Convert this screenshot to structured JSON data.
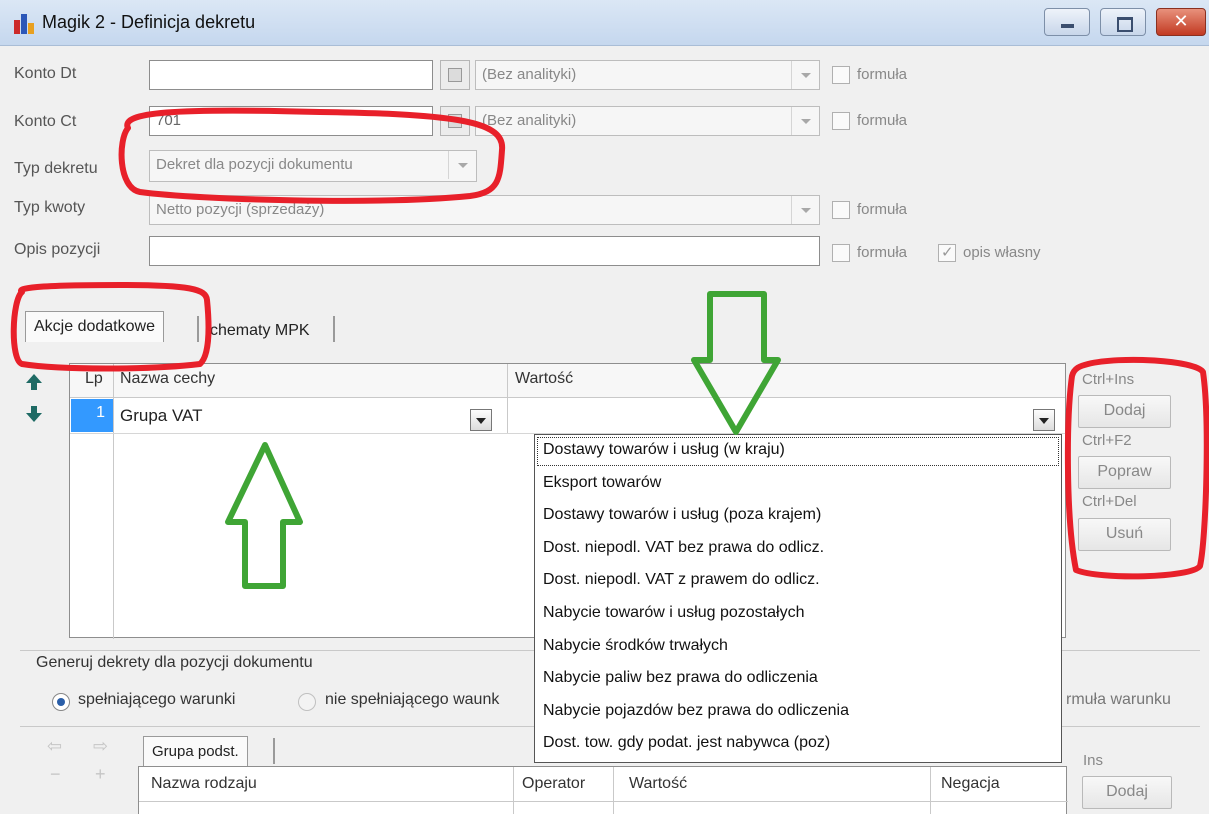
{
  "window": {
    "title": "Magik 2  - Definicja dekretu"
  },
  "form": {
    "konto_dt": {
      "label": "Konto Dt",
      "value": "",
      "analytics": "(Bez analityki)",
      "formula": "formuła"
    },
    "konto_ct": {
      "label": "Konto Ct",
      "value": "701",
      "analytics": "(Bez analityki)",
      "formula": "formuła"
    },
    "typ_dekretu": {
      "label": "Typ dekretu",
      "value": "Dekret dla pozycji dokumentu"
    },
    "typ_kwoty": {
      "label": "Typ kwoty",
      "value": "Netto pozycji (sprzedaży)",
      "formula": "formuła"
    },
    "opis_pozycji": {
      "label": "Opis pozycji",
      "value": "",
      "formula": "formuła",
      "own_description": "opis własny"
    }
  },
  "tabs": [
    {
      "label": "Akcje dodatkowe",
      "active": true
    },
    {
      "label": "chematy MPK",
      "active": false
    }
  ],
  "grid": {
    "columns": [
      "Lp",
      "Nazwa cechy",
      "Wartość"
    ],
    "rows": [
      {
        "lp": "1",
        "name": "Grupa VAT",
        "value": ""
      }
    ]
  },
  "dropdown": {
    "options": [
      "Dostawy towarów i usług (w kraju)",
      "Eksport towarów",
      "Dostawy towarów i usług (poza krajem)",
      "Dost. niepodl. VAT bez prawa do odlicz.",
      "Dost. niepodl. VAT z prawem do odlicz.",
      "Nabycie towarów i usług pozostałych",
      "Nabycie środków trwałych",
      "Nabycie paliw bez prawa do odliczenia",
      "Nabycie pojazdów bez prawa do odliczenia",
      "Dost. tow. gdy podat. jest nabywca (poz)"
    ]
  },
  "side_buttons": {
    "add": {
      "shortcut": "Ctrl+Ins",
      "label": "Dodaj"
    },
    "edit": {
      "shortcut": "Ctrl+F2",
      "label": "Popraw"
    },
    "delete": {
      "shortcut": "Ctrl+Del",
      "label": "Usuń"
    }
  },
  "generate": {
    "title": "Generuj dekrety dla pozycji dokumentu",
    "option_meeting": "spełniającego warunki",
    "option_not_meeting": "nie spełniającego waunk",
    "formula_condition": "rmuła warunku"
  },
  "bottom": {
    "tab": "Grupa podst.",
    "columns": [
      "Nazwa rodzaju",
      "Operator",
      "Wartość",
      "Negacja"
    ],
    "ins_shortcut": "Ins",
    "add_label": "Dodaj"
  },
  "colors": {
    "selection": "#3399ff",
    "annotation_red": "#e8202a",
    "annotation_green": "#3fa535"
  }
}
